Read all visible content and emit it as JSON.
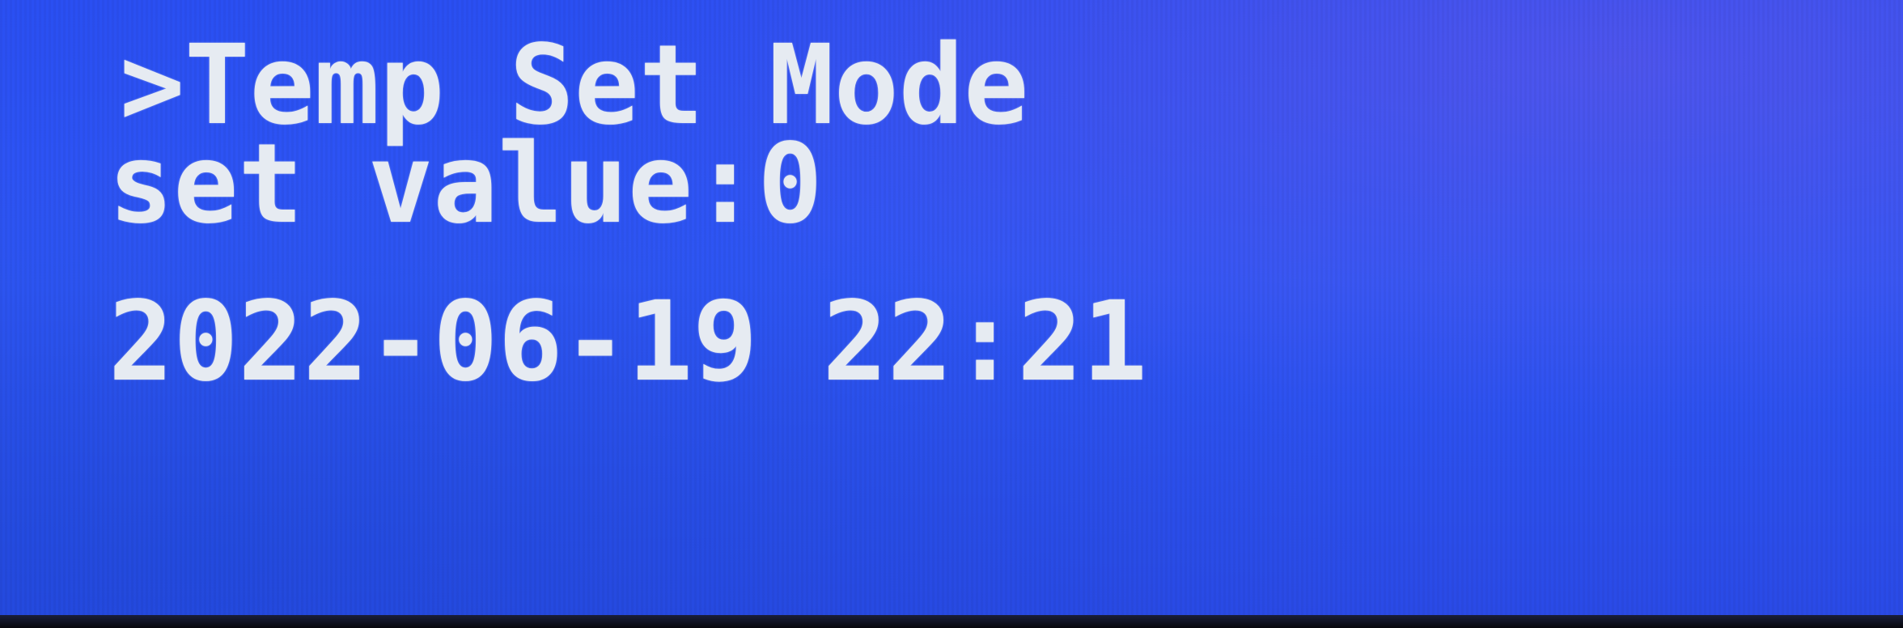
{
  "display": {
    "line1": ">Temp Set Mode",
    "line2": "set value:0",
    "line3": "",
    "line4": "2022-06-19 22:21"
  },
  "colors": {
    "background": "#2f56f5",
    "text": "#e6ebf2"
  }
}
